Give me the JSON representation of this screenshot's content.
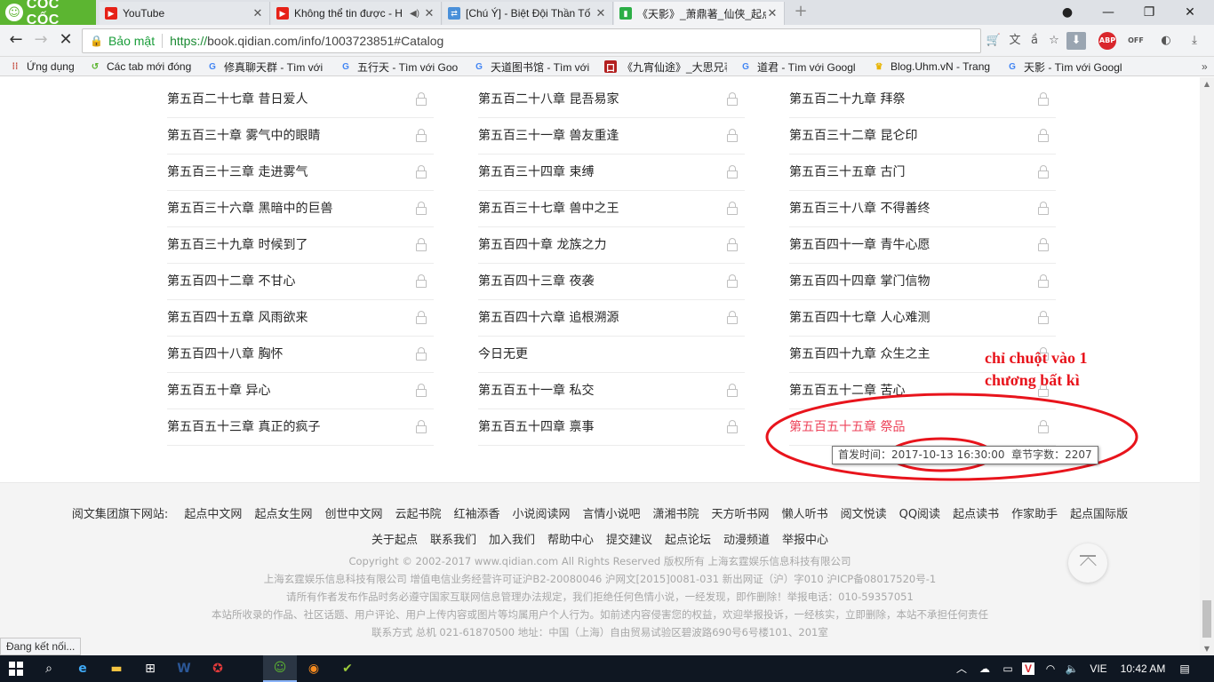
{
  "browser": {
    "brand": "CỐC CỐC",
    "tabs": [
      {
        "title": "YouTube",
        "icon": "youtube-icon"
      },
      {
        "title": "Không thể tin được - H",
        "icon": "youtube-icon",
        "audio": true
      },
      {
        "title": "[Chú Ý] - Biệt Đội Thần Tố",
        "icon": "forum-icon"
      },
      {
        "title": "《天影》_萧鼎著_仙侠_起点",
        "icon": "qidian-icon",
        "active": true
      }
    ],
    "secure_label": "Bảo mật",
    "url_protocol": "https://",
    "url_rest": "book.qidian.com/info/1003723851#Catalog",
    "status_text": "Đang kết nối..."
  },
  "bookmarks": [
    {
      "label": "Ứng dụng",
      "icon": "apps-grid-icon"
    },
    {
      "label": "Các tab mới đóng",
      "icon": "history-icon"
    },
    {
      "label": "修真聊天群 - Tìm với",
      "icon": "google-icon"
    },
    {
      "label": "五行天 - Tìm với Goo",
      "icon": "google-icon"
    },
    {
      "label": "天道图书馆 - Tìm với",
      "icon": "google-icon"
    },
    {
      "label": "《九宵仙途》_大思兄著",
      "icon": "bookmark-icon"
    },
    {
      "label": "道君 - Tìm với Googl",
      "icon": "google-icon"
    },
    {
      "label": "Blog.Uhm.vN - Trang",
      "icon": "crown-icon"
    },
    {
      "label": "天影 - Tìm với Googl",
      "icon": "google-icon"
    }
  ],
  "chapters": [
    [
      "第五百二十七章 昔日爱人",
      "第五百二十八章 昆吾易家",
      "第五百二十九章 拜祭"
    ],
    [
      "第五百三十章 雾气中的眼睛",
      "第五百三十一章 兽友重逢",
      "第五百三十二章 昆仑印"
    ],
    [
      "第五百三十三章 走进雾气",
      "第五百三十四章 束缚",
      "第五百三十五章 古门"
    ],
    [
      "第五百三十六章 黑暗中的巨兽",
      "第五百三十七章 兽中之王",
      "第五百三十八章 不得善终"
    ],
    [
      "第五百三十九章 时候到了",
      "第五百四十章 龙族之力",
      "第五百四十一章 青牛心愿"
    ],
    [
      "第五百四十二章 不甘心",
      "第五百四十三章 夜袭",
      "第五百四十四章 掌门信物"
    ],
    [
      "第五百四十五章 风雨欲来",
      "第五百四十六章 追根溯源",
      "第五百四十七章 人心难测"
    ],
    [
      "第五百四十八章 胸怀",
      "今日无更",
      "第五百四十九章 众生之主"
    ],
    [
      "第五百五十章 异心",
      "第五百五十一章 私交",
      "第五百五十二章 苦心"
    ],
    [
      "第五百五十三章 真正的疯子",
      "第五百五十四章 禀事",
      "第五百五十五章 祭品"
    ]
  ],
  "tooltip": {
    "label": "首发时间：",
    "time": "2017-10-13 16:30:00",
    "wordcount": "章节字数：2207"
  },
  "annotation": {
    "line1": "chỉ chuột vào 1",
    "line2": "chương bất kì"
  },
  "footer": {
    "sites_label": "阅文集团旗下网站:",
    "sites": [
      "起点中文网",
      "起点女生网",
      "创世中文网",
      "云起书院",
      "红袖添香",
      "小说阅读网",
      "言情小说吧",
      "潇湘书院",
      "天方听书网",
      "懒人听书",
      "阅文悦读",
      "QQ阅读",
      "起点读书",
      "作家助手",
      "起点国际版"
    ],
    "about": [
      "关于起点",
      "联系我们",
      "加入我们",
      "帮助中心",
      "提交建议",
      "起点论坛",
      "动漫频道",
      "举报中心"
    ],
    "copyright": "Copyright © 2002-2017 www.qidian.com All Rights Reserved 版权所有 上海玄霆娱乐信息科技有限公司",
    "license": "上海玄霆娱乐信息科技有限公司  增值电信业务经营许可证沪B2-20080046  沪网文[2015]0081-031  新出网证（沪）字010  沪ICP备08017520号-1",
    "notice": "请所有作者发布作品时务必遵守国家互联网信息管理办法规定，我们拒绝任何色情小说，一经发现，即作删除！举报电话：010-59357051",
    "rights": "本站所收录的作品、社区话题、用户评论、用户上传内容或图片等均属用户个人行为。如前述内容侵害您的权益，欢迎举报投诉，一经核实，立即删除，本站不承担任何责任",
    "contact": "联系方式  总机  021-61870500  地址：中国（上海）自由贸易试验区碧波路690号6号楼101、201室"
  },
  "taskbar": {
    "language": "VIE",
    "time": "10:42 AM"
  },
  "colors": {
    "brand_green": "#5cb531",
    "hover_red": "#ed4259",
    "annotation_red": "#e8141c"
  }
}
